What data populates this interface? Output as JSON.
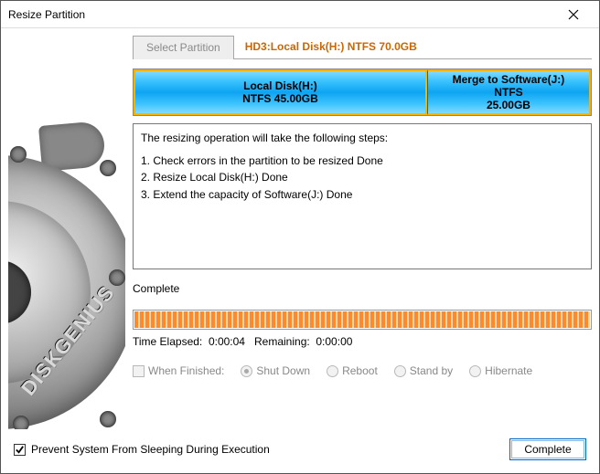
{
  "window": {
    "title": "Resize Partition"
  },
  "tab": {
    "label": "Select Partition",
    "description": "HD3:Local Disk(H:) NTFS 70.0GB"
  },
  "partitions": [
    {
      "title": "Local Disk(H:)",
      "fs_size": "NTFS 45.00GB"
    },
    {
      "title": "Merge to Software(J:)",
      "fs": "NTFS",
      "size": "25.00GB"
    }
  ],
  "steps_intro": "The resizing operation will take the following steps:",
  "steps": [
    "1. Check errors in the partition to be resized    Done",
    "2. Resize Local Disk(H:)    Done",
    "3. Extend the capacity of Software(J:)    Done"
  ],
  "status": "Complete",
  "time": {
    "elapsed_label": "Time Elapsed:",
    "elapsed": "0:00:04",
    "remaining_label": "Remaining:",
    "remaining": "0:00:00"
  },
  "options": {
    "when_finished": "When Finished:",
    "shutdown": "Shut Down",
    "reboot": "Reboot",
    "standby": "Stand by",
    "hibernate": "Hibernate"
  },
  "footer": {
    "prevent_sleep": "Prevent System From Sleeping During Execution",
    "complete_btn": "Complete"
  },
  "brand": "DISKGENIUS"
}
